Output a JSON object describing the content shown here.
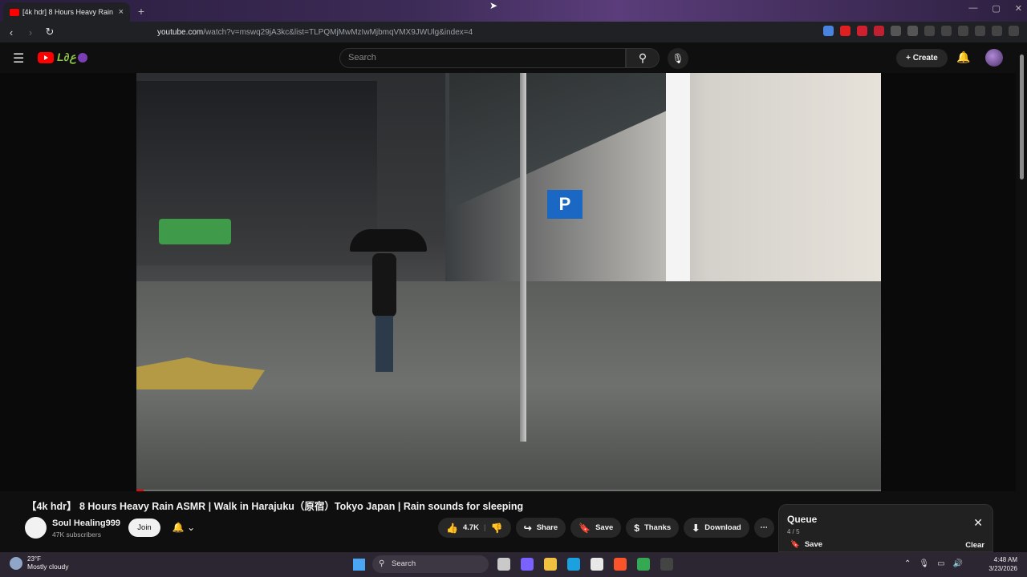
{
  "browser": {
    "tab_title": "[4k hdr] 8 Hours Heavy Rain",
    "tab_close": "×",
    "new_tab": "+",
    "window_controls": [
      "—",
      "▢",
      "✕"
    ],
    "url_host": "youtube.com",
    "url_path": "/watch?v=mswq29jA3kc&list=TLPQMjMwMzIwMjbmqVMX9JWUlg&index=4"
  },
  "youtube_header": {
    "search_placeholder": "Search",
    "create_label": "Create"
  },
  "video": {
    "title": "【4k hdr】 8 Hours Heavy Rain ASMR | Walk in Harajuku（原宿）Tokyo Japan | Rain sounds for sleeping",
    "progress_fraction": 0.01,
    "parking_sign": "P"
  },
  "channel": {
    "name": "Soul Healing999",
    "subscribers": "47K subscribers",
    "join_label": "Join"
  },
  "actions": {
    "likes": "4.7K",
    "share": "Share",
    "save": "Save",
    "thanks": "Thanks",
    "download": "Download"
  },
  "queue": {
    "title": "Queue",
    "count": "4 / 5",
    "save": "Save",
    "clear": "Clear"
  },
  "taskbar": {
    "temperature": "23°F",
    "weather": "Mostly cloudy",
    "search": "Search",
    "time": "4:48 AM",
    "date": "3/23/2026"
  },
  "colors": {
    "youtube_red": "#ff0000",
    "background": "#0f0f0f",
    "pill": "#272727"
  }
}
